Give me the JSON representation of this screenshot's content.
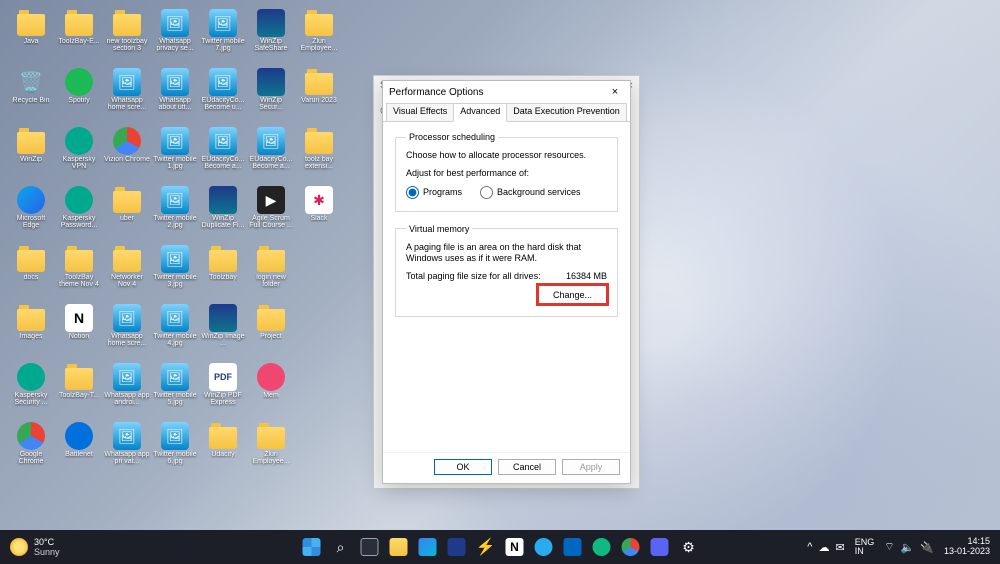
{
  "desktop_icons": [
    [
      {
        "label": "Java",
        "icon": "folder"
      },
      {
        "label": "Recycle Bin",
        "icon": "bin"
      },
      {
        "label": "WinZip",
        "icon": "folder"
      },
      {
        "label": "Microsoft Edge",
        "icon": "edge"
      },
      {
        "label": "docs",
        "icon": "folder"
      },
      {
        "label": "Images",
        "icon": "folder"
      },
      {
        "label": "Kaspersky Security ...",
        "icon": "kasper"
      },
      {
        "label": "Google Chrome",
        "icon": "chrome"
      }
    ],
    [
      {
        "label": "ToolzBay-E...",
        "icon": "folder"
      },
      {
        "label": "Spotify",
        "icon": "spotify"
      },
      {
        "label": "Kaspersky VPN",
        "icon": "kasper"
      },
      {
        "label": "Kaspersky Password...",
        "icon": "kasper"
      },
      {
        "label": "ToolzBay theme Nov 4",
        "icon": "folder"
      },
      {
        "label": "Notion",
        "icon": "notion"
      },
      {
        "label": "ToolzBay-T...",
        "icon": "folder"
      },
      {
        "label": "Battlenet",
        "icon": "bnet"
      }
    ],
    [
      {
        "label": "new toolzbay section 3",
        "icon": "folder"
      },
      {
        "label": "Whatsapp home scre...",
        "icon": "img"
      },
      {
        "label": "Vizion Chrome",
        "icon": "chrome"
      },
      {
        "label": "uber",
        "icon": "folder"
      },
      {
        "label": "Networker Nov 4",
        "icon": "folder"
      },
      {
        "label": "Whatsapp home scre...",
        "icon": "img"
      },
      {
        "label": "Whatsapp app androi...",
        "icon": "img"
      },
      {
        "label": "Whatsapp app pri vat...",
        "icon": "img"
      }
    ],
    [
      {
        "label": "Whatsapp privacy se...",
        "icon": "img"
      },
      {
        "label": "Whatsapp about utt...",
        "icon": "img"
      },
      {
        "label": "Twitter mobile 1.jpg",
        "icon": "img"
      },
      {
        "label": "Twitter mobile 2.jpg",
        "icon": "img"
      },
      {
        "label": "Twitter mobile 3.jpg",
        "icon": "img"
      },
      {
        "label": "Twitter mobile 4.jpg",
        "icon": "img"
      },
      {
        "label": "Twitter mobile 5.jpg",
        "icon": "img"
      },
      {
        "label": "Twitter mobile 6.jpg",
        "icon": "img"
      }
    ],
    [
      {
        "label": "Twitter mobile 7.jpg",
        "icon": "img"
      },
      {
        "label": "EUdacityCo... Become u...",
        "icon": "img"
      },
      {
        "label": "EUdacityCo... Become a...",
        "icon": "img"
      },
      {
        "label": "WinZip Duplicate Fi...",
        "icon": "winzip"
      },
      {
        "label": "Toolzbay",
        "icon": "folder"
      },
      {
        "label": "WinZip Image ...",
        "icon": "winzip"
      },
      {
        "label": "WinZip PDF Express",
        "icon": "pdf"
      },
      {
        "label": "Udacity",
        "icon": "folder"
      }
    ],
    [
      {
        "label": "WinZip SafeShare",
        "icon": "winzip"
      },
      {
        "label": "WinZip Secur...",
        "icon": "winzip"
      },
      {
        "label": "EUdacityCo... Become a...",
        "icon": "img"
      },
      {
        "label": "Agile Scrum Full Course ...",
        "icon": "video"
      },
      {
        "label": "login new folder",
        "icon": "folder"
      },
      {
        "label": "Project",
        "icon": "folder"
      },
      {
        "label": "Mem",
        "icon": "mem"
      },
      {
        "label": "Zluri Employee...",
        "icon": "folder"
      }
    ],
    [
      {
        "label": "Zluri Employee...",
        "icon": "folder"
      },
      {
        "label": "Varun 2023",
        "icon": "folder"
      },
      {
        "label": "toolz bay extensi...",
        "icon": "folder"
      },
      {
        "label": "Slack",
        "icon": "slack"
      }
    ]
  ],
  "behind_dialog_label_left": "Sy",
  "behind_dialog_label_right": "Ca",
  "dialog": {
    "title": "Performance Options",
    "tabs": [
      "Visual Effects",
      "Advanced",
      "Data Execution Prevention"
    ],
    "active_tab": "Advanced",
    "proc_sched": {
      "legend": "Processor scheduling",
      "desc": "Choose how to allocate processor resources.",
      "adjust": "Adjust for best performance of:",
      "opt_programs": "Programs",
      "opt_bg": "Background services"
    },
    "vm": {
      "legend": "Virtual memory",
      "desc": "A paging file is an area on the hard disk that Windows uses as if it were RAM.",
      "total_label": "Total paging file size for all drives:",
      "total_value": "16384 MB",
      "change": "Change..."
    },
    "ok": "OK",
    "cancel": "Cancel",
    "apply": "Apply"
  },
  "taskbar": {
    "weather_temp": "30°C",
    "weather_desc": "Sunny",
    "lang1": "ENG",
    "lang2": "IN",
    "time": "14:15",
    "date": "13-01-2023"
  }
}
